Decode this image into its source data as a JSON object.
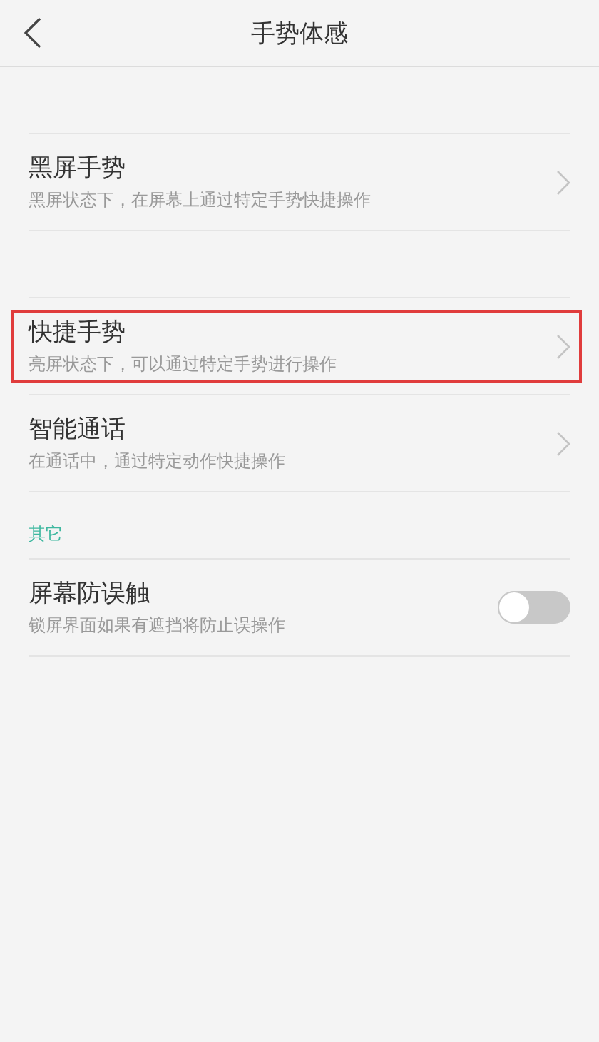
{
  "header": {
    "title": "手势体感"
  },
  "groups": [
    {
      "items": [
        {
          "kind": "link",
          "title": "黑屏手势",
          "subtitle": "黑屏状态下，在屏幕上通过特定手势快捷操作",
          "highlighted": false
        }
      ]
    },
    {
      "items": [
        {
          "kind": "link",
          "title": "快捷手势",
          "subtitle": "亮屏状态下，可以通过特定手势进行操作",
          "highlighted": true
        },
        {
          "kind": "link",
          "title": "智能通话",
          "subtitle": "在通话中，通过特定动作快捷操作",
          "highlighted": false
        }
      ]
    },
    {
      "title": "其它",
      "items": [
        {
          "kind": "toggle",
          "title": "屏幕防误触",
          "subtitle": "锁屏界面如果有遮挡将防止误操作",
          "on": false,
          "highlighted": false
        }
      ]
    }
  ]
}
